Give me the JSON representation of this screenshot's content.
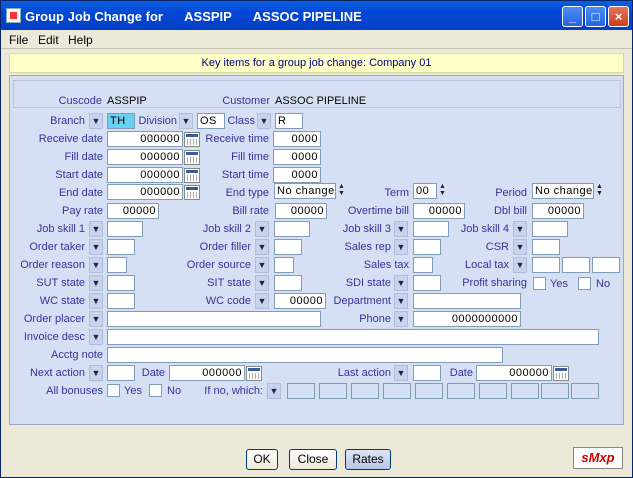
{
  "window": {
    "title": "Group Job Change for      ASSPIP      ASSOC PIPELINE",
    "min": "_",
    "max": "□",
    "close": "×"
  },
  "menu": [
    {
      "label": "File"
    },
    {
      "label": "Edit"
    },
    {
      "label": "Help"
    }
  ],
  "banner": "Key items for a group job change: Company 01",
  "cust": {
    "cuscode_label": "Cuscode",
    "cuscode": "ASSPIP",
    "customer_label": "Customer",
    "customer": "ASSOC PIPELINE"
  },
  "labels": {
    "branch": "Branch",
    "division": "Division",
    "class": "Class",
    "receive_date": "Receive date",
    "receive_time": "Receive time",
    "fill_date": "Fill date",
    "fill_time": "Fill time",
    "start_date": "Start date",
    "start_time": "Start time",
    "end_date": "End date",
    "end_type": "End type",
    "term": "Term",
    "period": "Period",
    "pay_rate": "Pay rate",
    "bill_rate": "Bill rate",
    "overtime_bill": "Overtime bill",
    "dbl_bill": "Dbl bill",
    "job_skill_1": "Job skill 1",
    "job_skill_2": "Job skill 2",
    "job_skill_3": "Job skill 3",
    "job_skill_4": "Job skill 4",
    "order_taker": "Order taker",
    "order_filler": "Order filler",
    "sales_rep": "Sales rep",
    "csr": "CSR",
    "order_reason": "Order reason",
    "order_source": "Order source",
    "sales_tax": "Sales tax",
    "local_tax": "Local tax",
    "sut_state": "SUT state",
    "sit_state": "SIT state",
    "sdi_state": "SDI state",
    "profit_sharing": "Profit sharing",
    "wc_state": "WC state",
    "wc_code": "WC code",
    "department": "Department",
    "order_placer": "Order placer",
    "phone": "Phone",
    "invoice_desc": "Invoice desc",
    "acctg_note": "Acctg note",
    "next_action": "Next action",
    "date": "Date",
    "last_action": "Last action",
    "all_bonuses": "All bonuses",
    "if_no_which": "If no, which:",
    "yes": "Yes",
    "no": "No"
  },
  "values": {
    "branch": "TH",
    "division": "OS",
    "class": "R",
    "receive_date": "000000",
    "receive_time": "0000",
    "fill_date": "000000",
    "fill_time": "0000",
    "start_date": "000000",
    "start_time": "0000",
    "end_date": "000000",
    "end_type": "No change",
    "term": "00",
    "period": "No change",
    "pay_rate": "00000",
    "bill_rate": "00000",
    "overtime_bill": "00000",
    "dbl_bill": "00000",
    "wc_code": "00000",
    "phone": "0000000000",
    "next_action_date": "000000",
    "last_action_date": "000000"
  },
  "buttons": {
    "ok": "OK",
    "close": "Close",
    "rates": "Rates"
  },
  "logo": "sMxp"
}
